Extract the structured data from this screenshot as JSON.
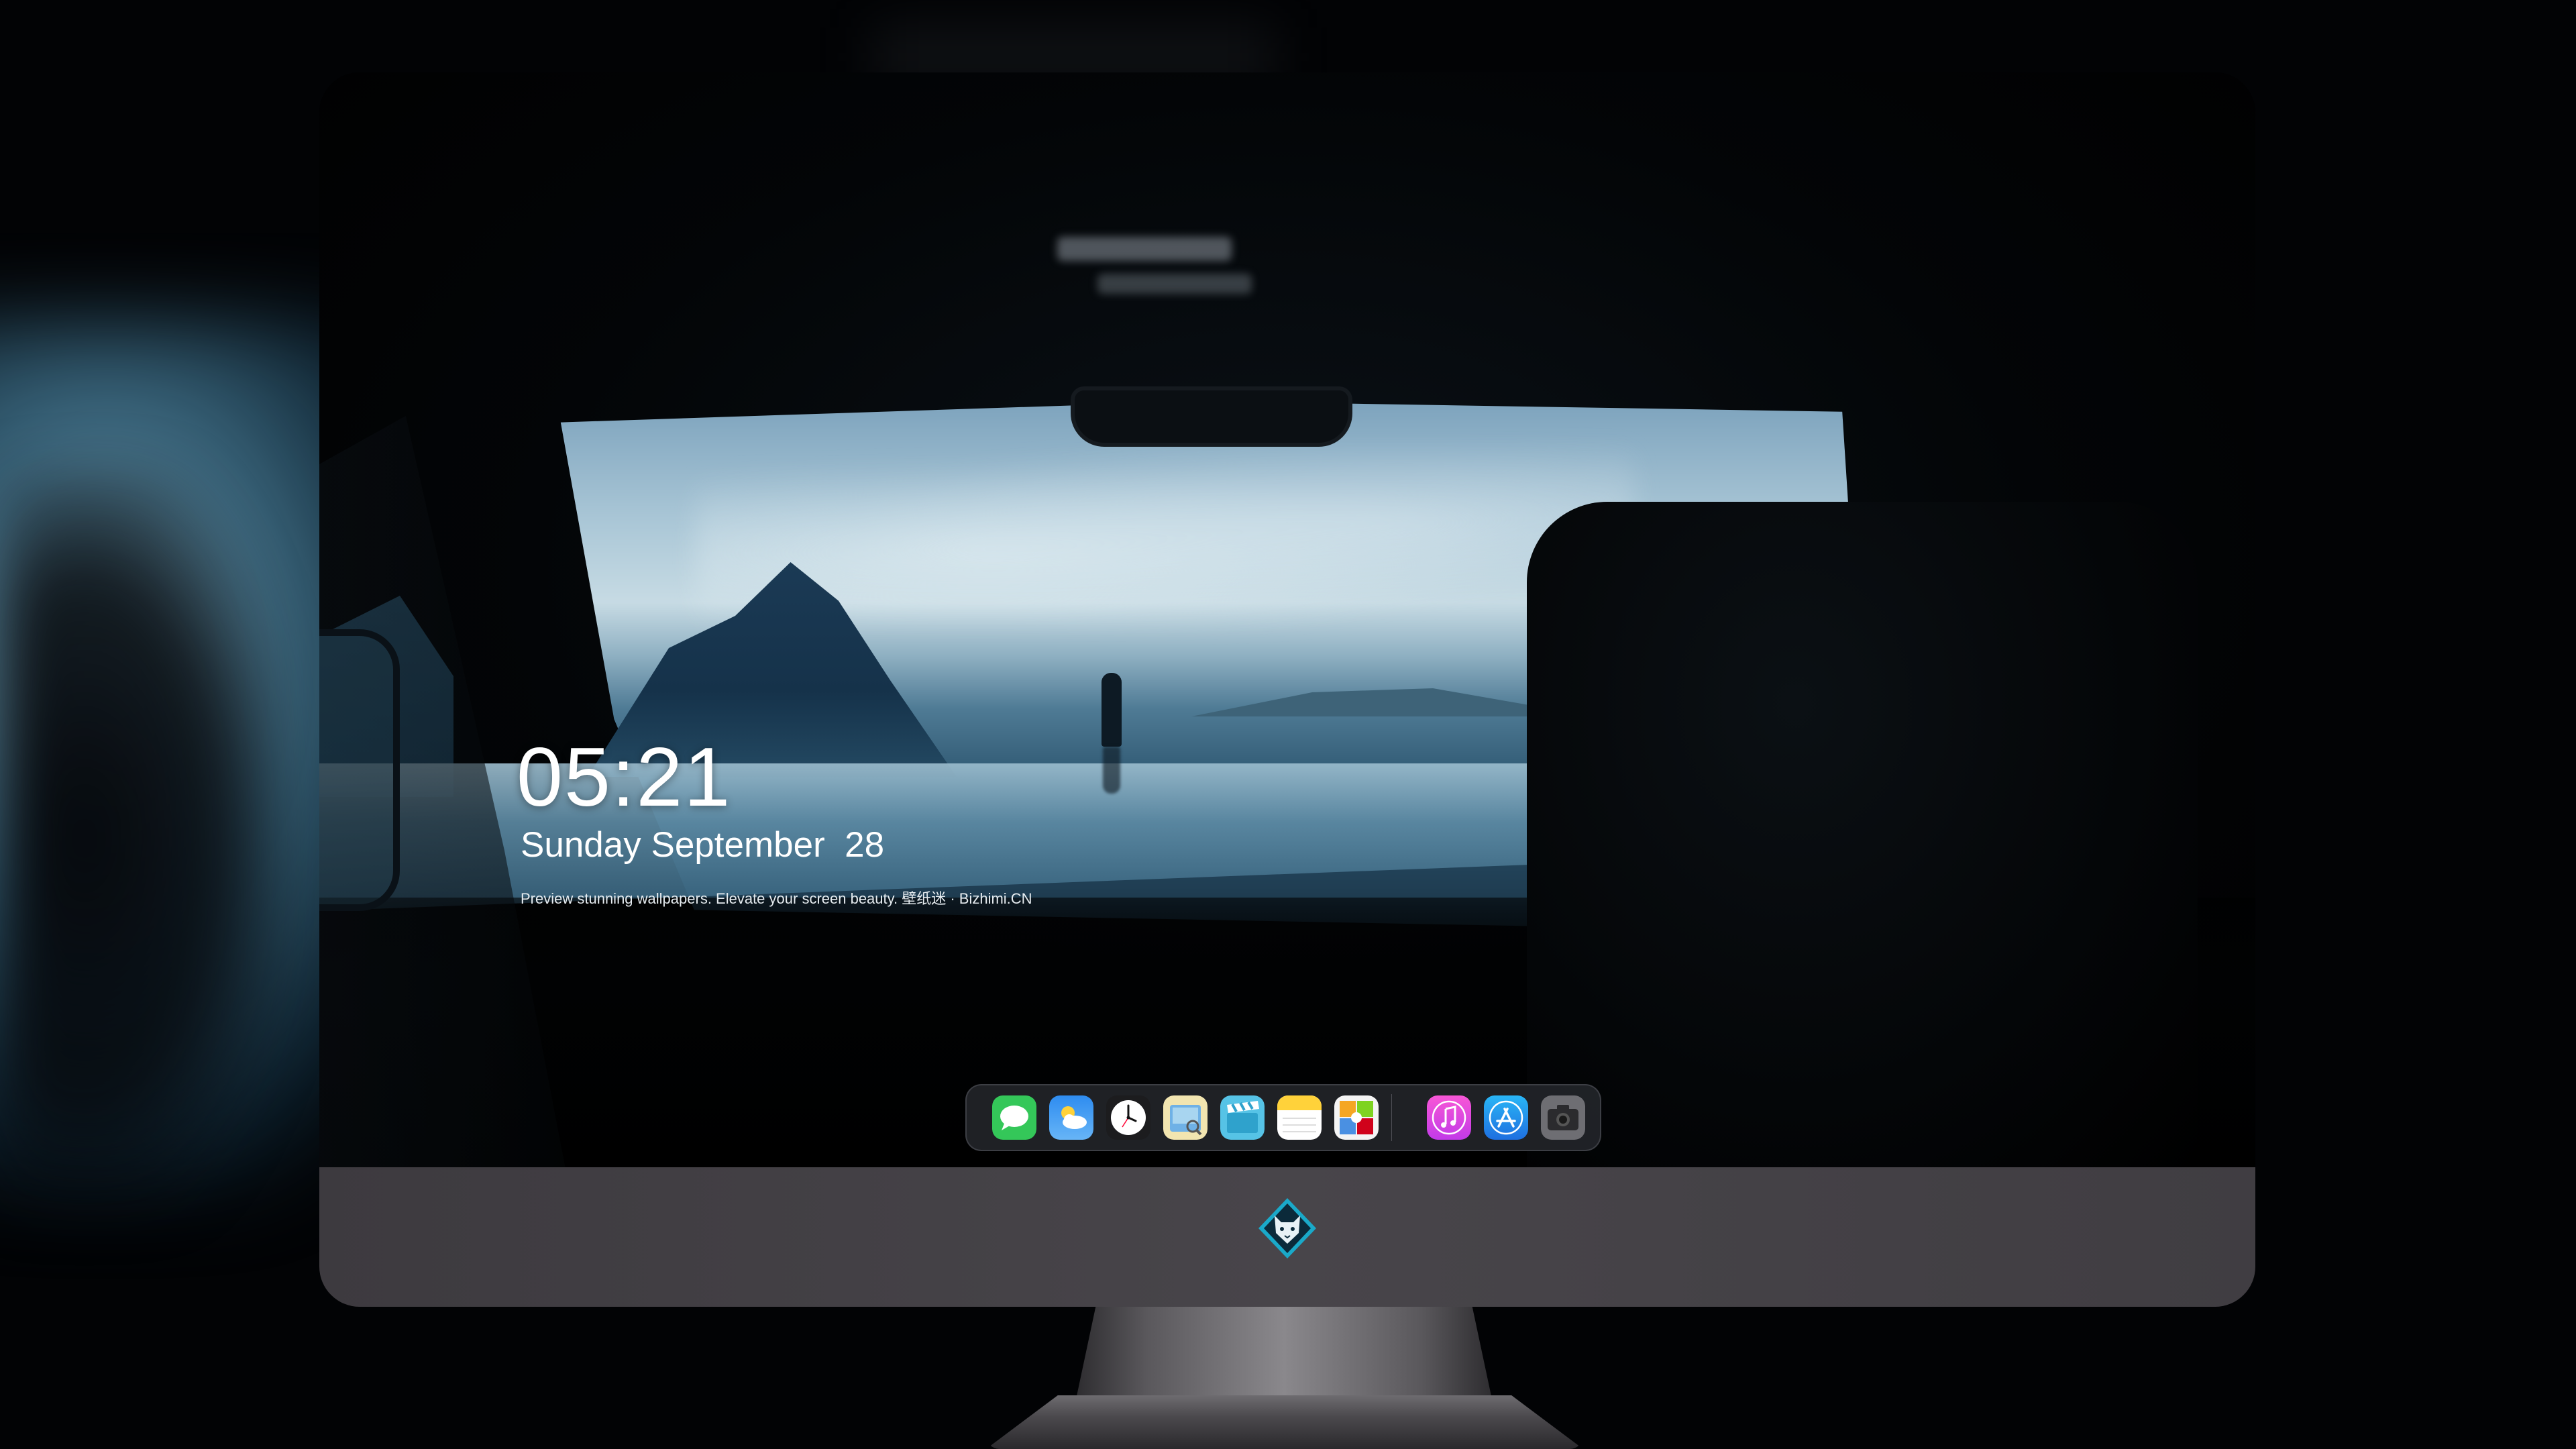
{
  "lock_screen": {
    "time": "05:21",
    "date": "Sunday September  28",
    "tagline": "Preview stunning wallpapers. Elevate your screen beauty. 壁纸迷 · Bizhimi.CN"
  },
  "dock": {
    "items": [
      {
        "name": "messages-icon",
        "label": "Messages"
      },
      {
        "name": "weather-icon",
        "label": "Weather"
      },
      {
        "name": "clock-icon",
        "label": "Clock"
      },
      {
        "name": "preview-icon",
        "label": "Preview"
      },
      {
        "name": "clapper-icon",
        "label": "Video"
      },
      {
        "name": "notes-icon",
        "label": "Notes"
      },
      {
        "name": "photo-booth-icon",
        "label": "Photos"
      },
      {
        "name": "music-icon",
        "label": "Music"
      },
      {
        "name": "app-store-icon",
        "label": "App Store"
      },
      {
        "name": "camera-icon",
        "label": "Camera"
      }
    ]
  },
  "colors": {
    "background": "#020305",
    "chin": "#45424a",
    "dock": "#282a30",
    "text": "#ffffff"
  },
  "chin": {
    "logo": "wolf-mascot-logo"
  }
}
